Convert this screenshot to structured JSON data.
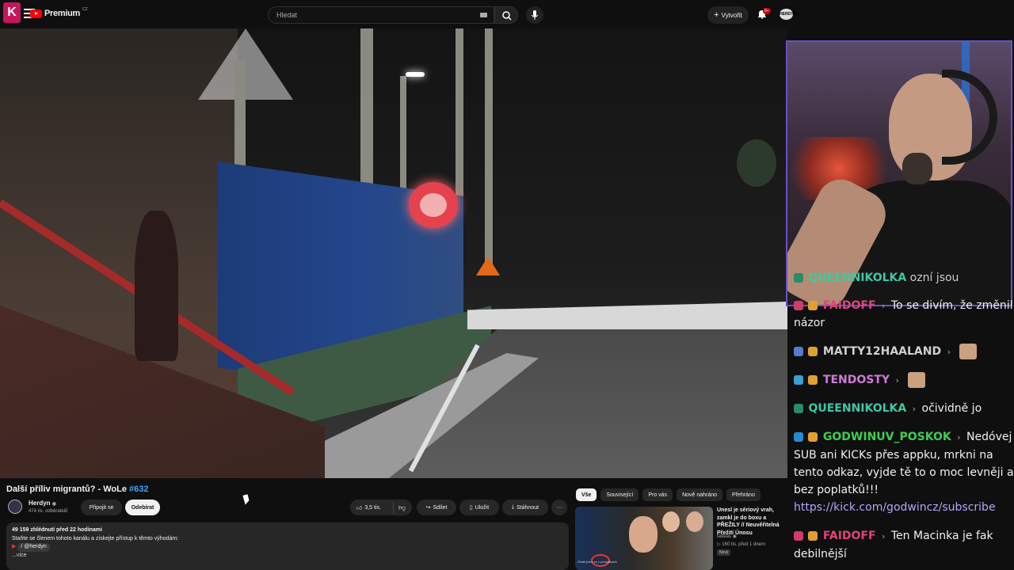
{
  "stream_logo": "K",
  "topbar": {
    "logo_text": "Premium",
    "region": "CZ",
    "search_placeholder": "Hledat",
    "create_label": "Vytvořit",
    "notif_count": "9+",
    "avatar_text": "HERDYN"
  },
  "video": {
    "title": "Další příliv migrantů? - WoLe ",
    "tag": "#632",
    "channel_name": "Herdyn",
    "subscribers": "474 tis. odběratelů",
    "join_label": "Připojit se",
    "subscribe_label": "Odebírat",
    "likes": "3,5 tis.",
    "share_label": "Sdílet",
    "save_label": "Uložit",
    "download_label": "Stáhnout",
    "more_label": "···"
  },
  "description": {
    "stats": "49 159 zhlédnutí  před 22 hodinami",
    "line1": "Staňte se členem tohoto kanálu a získejte přístup k těmto výhodám:",
    "chip": "/ @herdyn",
    "more": "...více"
  },
  "chips": [
    "Vše",
    "Související",
    "Pro vás",
    "Nově nahráno",
    "Přehráno"
  ],
  "recommendation": {
    "title": "Unesl je sériový vrah, zamkl je do boxu a PŘEŽILY // Neuvěřitelná Přežití Únosu",
    "channel": "tadeas",
    "meta": "160 tis.  před 1 dnem",
    "badge": "Nový",
    "thumb_caption": "Ztratil jsem se v poupátkách"
  },
  "chat": [
    {
      "user": "QUEENNIKOLKA",
      "color": "#3ec9a0",
      "text": "ozní jsou",
      "icon_color": "#2a8a6a"
    },
    {
      "user": "FAIDOFF",
      "color": "#e0447a",
      "text": "To se divím, že změnil",
      "icon_color": "#d23a6a"
    },
    {
      "user": "",
      "color": "#aaa",
      "text": "názor",
      "icon_color": ""
    },
    {
      "user": "MATTY12HAALAND",
      "color": "#d0d0d0",
      "text": "",
      "icon_color": "#5a7ad0"
    },
    {
      "user": "TENDOSTY",
      "color": "#d07ad8",
      "text": "",
      "icon_color": "#3aa0d0"
    },
    {
      "user": "QUEENNIKOLKA",
      "color": "#3ec9a0",
      "text": "očividně jo",
      "icon_color": "#2a8a6a"
    },
    {
      "user": "GODWINUV_POSKOK",
      "color": "#3ed050",
      "text": "Nedóvej SUB ani KICKs přes appku, mrkni na tento odkaz, vyjde tě to o moc levněji a bez poplatků!!!",
      "icon_color": "#2a8ad0"
    },
    {
      "user": "",
      "color": "#aaa",
      "text": "https://kick.com/godwincz/subscribe",
      "icon_color": ""
    },
    {
      "user": "FAIDOFF",
      "color": "#e0447a",
      "text": "Ten Macinka je fak debilnější",
      "icon_color": "#d23a6a"
    }
  ]
}
